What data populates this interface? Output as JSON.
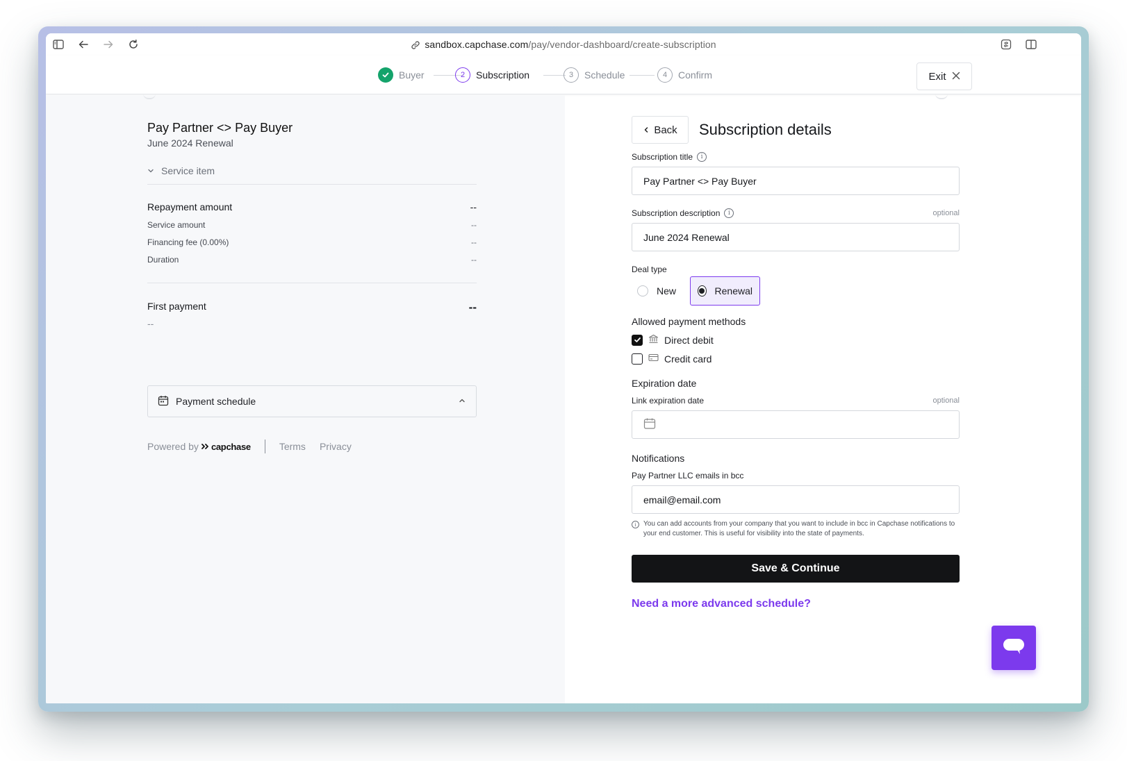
{
  "browser": {
    "url_host": "sandbox.capchase.com",
    "url_path": "/pay/vendor-dashboard/create-subscription"
  },
  "stepper": {
    "steps": [
      {
        "label": "Buyer",
        "number": "",
        "state": "done"
      },
      {
        "label": "Subscription",
        "number": "2",
        "state": "active"
      },
      {
        "label": "Schedule",
        "number": "3",
        "state": "pending"
      },
      {
        "label": "Confirm",
        "number": "4",
        "state": "pending"
      }
    ],
    "exit_label": "Exit"
  },
  "summary": {
    "title": "Pay Partner <> Pay Buyer",
    "subtitle": "June 2024 Renewal",
    "service_item_label": "Service item",
    "repayment_amount_label": "Repayment amount",
    "repayment_amount_value": "--",
    "service_amount_label": "Service amount",
    "service_amount_value": "--",
    "financing_fee_label": "Financing fee (0.00%)",
    "financing_fee_value": "--",
    "duration_label": "Duration",
    "duration_value": "--",
    "first_payment_label": "First payment",
    "first_payment_value": "--",
    "first_payment_date": "--",
    "payment_schedule_label": "Payment schedule",
    "powered_by": "Powered by",
    "brand": "capchase",
    "terms": "Terms",
    "privacy": "Privacy"
  },
  "form": {
    "back_label": "Back",
    "title": "Subscription details",
    "subscription_title_label": "Subscription title",
    "subscription_title_value": "Pay Partner <> Pay Buyer",
    "subscription_description_label": "Subscription description",
    "optional": "optional",
    "subscription_description_value": "June 2024 Renewal",
    "deal_type_label": "Deal type",
    "deal_type_options": [
      "New",
      "Renewal"
    ],
    "deal_type_selected": "Renewal",
    "payment_methods_label": "Allowed payment methods",
    "payment_methods": [
      {
        "label": "Direct debit",
        "checked": true,
        "icon": "bank-icon"
      },
      {
        "label": "Credit card",
        "checked": false,
        "icon": "credit-card-icon"
      }
    ],
    "expiration_section_label": "Expiration date",
    "link_expiration_label": "Link expiration date",
    "link_expiration_value": "",
    "notifications_label": "Notifications",
    "bcc_label": "Pay Partner LLC emails in bcc",
    "bcc_value": "email@email.com",
    "bcc_help": "You can add accounts from your company that you want to include in bcc in Capchase notifications to your end customer. This is useful for visibility into the state of payments.",
    "save_label": "Save & Continue",
    "advanced_link": "Need a more advanced schedule?"
  },
  "colors": {
    "accent": "#7c3aed",
    "success": "#14a36b",
    "primary_button": "#131416"
  }
}
